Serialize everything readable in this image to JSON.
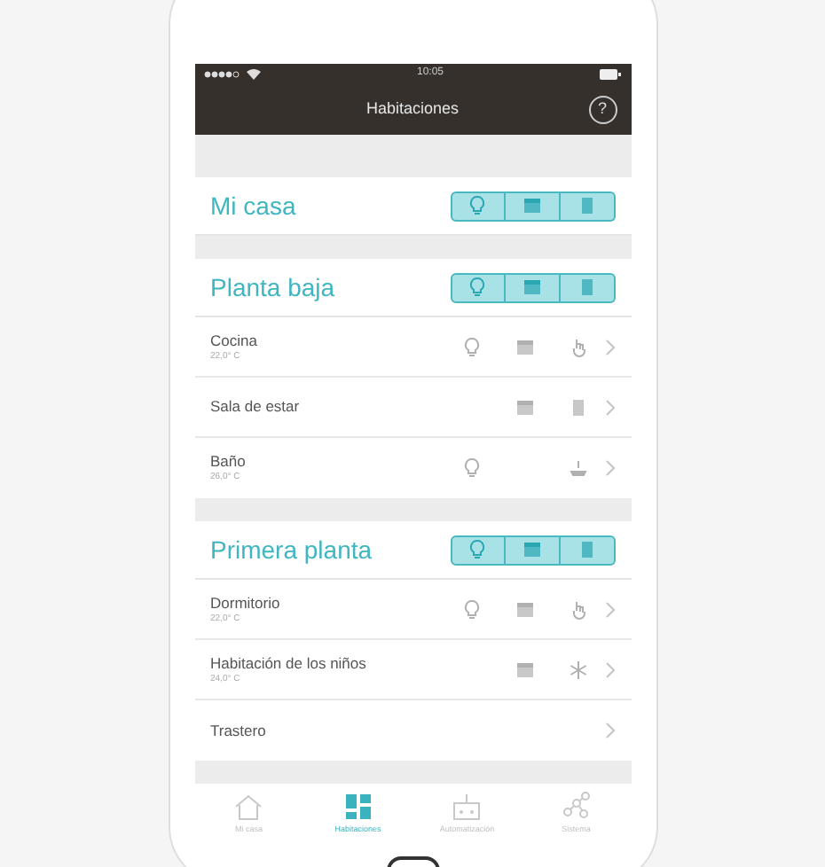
{
  "status_bar": {
    "time": "10:05"
  },
  "header": {
    "title": "Habitaciones",
    "help": "?"
  },
  "sections": [
    {
      "title": "Mi casa"
    },
    {
      "title": "Planta baja",
      "rooms": [
        {
          "name": "Cocina",
          "temperature": "22,0° C",
          "icons": [
            {
              "kind": "light"
            },
            {
              "kind": "blind"
            },
            {
              "kind": "hand"
            }
          ]
        },
        {
          "name": "Sala de estar",
          "icons": [
            {
              "kind": "empty"
            },
            {
              "kind": "blind"
            },
            {
              "kind": "door"
            }
          ]
        },
        {
          "name": "Baño",
          "temperature": "26,0° C",
          "icons": [
            {
              "kind": "light"
            },
            {
              "kind": "empty"
            },
            {
              "kind": "heater"
            }
          ]
        }
      ]
    },
    {
      "title": "Primera planta",
      "rooms": [
        {
          "name": "Dormitorio",
          "temperature": "22,0° C",
          "icons": [
            {
              "kind": "light"
            },
            {
              "kind": "blind"
            },
            {
              "kind": "hand"
            }
          ]
        },
        {
          "name": "Habitación de los niños",
          "temperature": "24,0° C",
          "icons": [
            {
              "kind": "empty"
            },
            {
              "kind": "blind"
            },
            {
              "kind": "snowflake"
            }
          ]
        },
        {
          "name": "Trastero",
          "icons": [
            {
              "kind": "empty"
            },
            {
              "kind": "empty"
            },
            {
              "kind": "empty"
            }
          ]
        }
      ]
    }
  ],
  "tab_bar": [
    {
      "label": "Mi casa",
      "kind": "home",
      "selected": false
    },
    {
      "label": "Habitaciones",
      "kind": "rooms",
      "selected": true
    },
    {
      "label": "Automatización",
      "kind": "robot",
      "selected": false
    },
    {
      "label": "Sistema",
      "kind": "network",
      "selected": false
    }
  ]
}
